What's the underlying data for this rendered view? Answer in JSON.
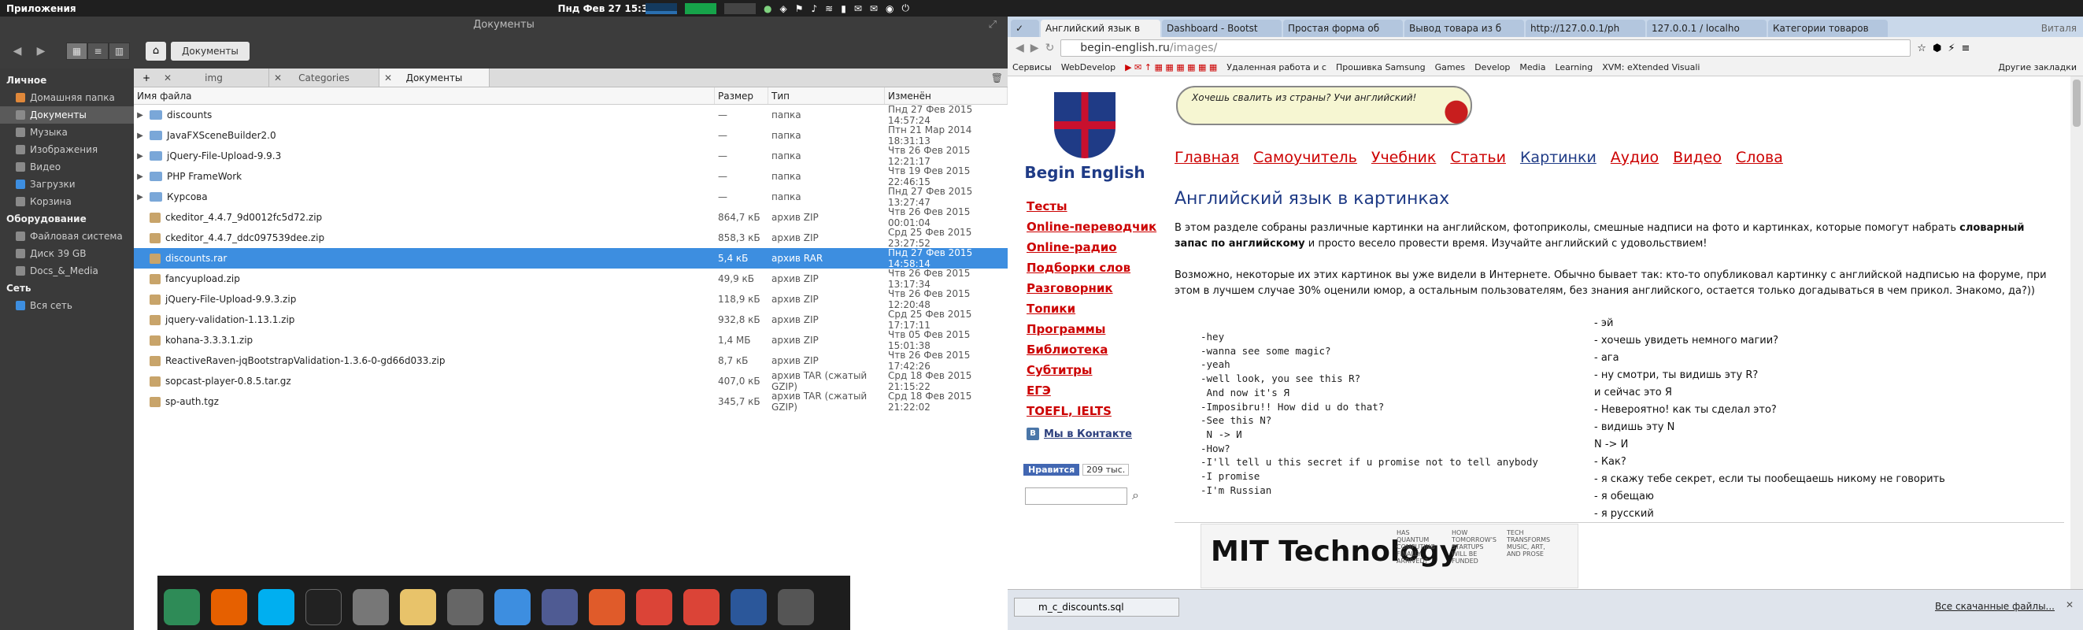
{
  "topbar": {
    "apps": "Приложения",
    "clock": "Пнд Фев 27 15:31"
  },
  "filemanager": {
    "title": "Документы",
    "breadcrumb": "Документы",
    "sidebar": {
      "personal_header": "Личное",
      "personal": [
        "Домашняя папка",
        "Документы",
        "Музыка",
        "Изображения",
        "Видео",
        "Загрузки",
        "Корзина"
      ],
      "hardware_header": "Оборудование",
      "hardware": [
        "Файловая система",
        "Диск 39 GB",
        "Docs_&_Media"
      ],
      "network_header": "Сеть",
      "network": [
        "Вся сеть"
      ]
    },
    "tabs": [
      "img",
      "Categories",
      "Документы"
    ],
    "columns": {
      "name": "Имя файла",
      "size": "Размер",
      "type": "Тип",
      "modified": "Изменён"
    },
    "rows": [
      {
        "name": "discounts",
        "size": "—",
        "type": "папка",
        "modified": "Пнд 27 Фев 2015 14:57:24"
      },
      {
        "name": "JavaFXSceneBuilder2.0",
        "size": "—",
        "type": "папка",
        "modified": "Птн 21 Мар 2014 18:31:13"
      },
      {
        "name": "jQuery-File-Upload-9.9.3",
        "size": "—",
        "type": "папка",
        "modified": "Чтв 26 Фев 2015 12:21:17"
      },
      {
        "name": "PHP FrameWork",
        "size": "—",
        "type": "папка",
        "modified": "Чтв 19 Фев 2015 22:46:15"
      },
      {
        "name": "Курсова",
        "size": "—",
        "type": "папка",
        "modified": "Пнд 27 Фев 2015 13:27:47"
      },
      {
        "name": "ckeditor_4.4.7_9d0012fc5d72.zip",
        "size": "864,7 кБ",
        "type": "архив ZIP",
        "modified": "Чтв 26 Фев 2015 00:01:04"
      },
      {
        "name": "ckeditor_4.4.7_ddc097539dee.zip",
        "size": "858,3 кБ",
        "type": "архив ZIP",
        "modified": "Срд 25 Фев 2015 23:27:52"
      },
      {
        "name": "discounts.rar",
        "size": "5,4 кБ",
        "type": "архив RAR",
        "modified": "Пнд 27 Фев 2015 14:58:14"
      },
      {
        "name": "fancyupload.zip",
        "size": "49,9 кБ",
        "type": "архив ZIP",
        "modified": "Чтв 26 Фев 2015 13:17:34"
      },
      {
        "name": "jQuery-File-Upload-9.9.3.zip",
        "size": "118,9 кБ",
        "type": "архив ZIP",
        "modified": "Чтв 26 Фев 2015 12:20:48"
      },
      {
        "name": "jquery-validation-1.13.1.zip",
        "size": "932,8 кБ",
        "type": "архив ZIP",
        "modified": "Срд 25 Фев 2015 17:17:11"
      },
      {
        "name": "kohana-3.3.3.1.zip",
        "size": "1,4 МБ",
        "type": "архив ZIP",
        "modified": "Чтв 05 Фев 2015 15:01:38"
      },
      {
        "name": "ReactiveRaven-jqBootstrapValidation-1.3.6-0-gd66d033.zip",
        "size": "8,7 кБ",
        "type": "архив ZIP",
        "modified": "Чтв 26 Фев 2015 17:42:26"
      },
      {
        "name": "sopcast-player-0.8.5.tar.gz",
        "size": "407,0 кБ",
        "type": "архив TAR (сжатый GZIP)",
        "modified": "Срд 18 Фев 2015 21:15:22"
      },
      {
        "name": "sp-auth.tgz",
        "size": "345,7 кБ",
        "type": "архив TAR (сжатый GZIP)",
        "modified": "Срд 18 Фев 2015 21:22:02"
      }
    ]
  },
  "browser": {
    "tabs": [
      "Английский язык в",
      "Dashboard - Bootst",
      "Простая форма об",
      "Вывод товара из б",
      "http://127.0.0.1/ph",
      "127.0.0.1 / localho",
      "Категории товаров"
    ],
    "user": "Виталя",
    "url_host": "begin-english.ru",
    "url_path": "/images/",
    "bookmarks": [
      "Сервисы",
      "WebDevelop",
      "Удаленная работа и с",
      "Прошивка Samsung",
      "Games",
      "Develop",
      "Media",
      "Learning",
      "XVM: eXtended Visuali"
    ],
    "bookmarks_other": "Другие закладки",
    "site": {
      "logo": "Begin English",
      "bubble": "Хочешь свалить из страны? Учи английский!",
      "topnav": [
        "Главная",
        "Самоучитель",
        "Учебник",
        "Статьи",
        "Картинки",
        "Аудио",
        "Видео",
        "Слова"
      ],
      "leftnav": [
        "Тесты",
        "Online-переводчик",
        "Online-радио",
        "Подборки слов",
        "Разговорник",
        "Топики",
        "Программы",
        "Библиотека",
        "Субтитры",
        "ЕГЭ",
        "TOEFL, IELTS"
      ],
      "vk": "Мы в Контакте",
      "fb_like": "Нравится",
      "fb_count": "209 тыс.",
      "heading": "Английский язык в картинках",
      "p1_a": "В этом разделе собраны различные картинки на английском, фотоприколы, смешные надписи на фото и картинках, которые помогут  набрать ",
      "p1_b": "словарный запас по английскому",
      "p1_c": " и просто весело провести время. Изучайте английский с удовольствием!",
      "p2": "Возможно, некоторые их этих картинок вы уже видели в Интернете. Обычно бывает так: кто-то опубликовал картинку с английской надписью на форуме, при этом в лучшем случае 30% оценили юмор, а остальным пользователям, без знания английского, остается только догадываться в чем прикол. Знакомо, да?))",
      "code": "-hey\n-wanna see some magic?\n-yeah\n-well look, you see this R?\n And now it's Я\n-Imposibru!! How did u do that?\n-See this N?\n N -> И\n-How?\n-I'll tell u this secret if u promise not to tell anybody\n-I promise\n-I'm Russian",
      "translation": [
        "- эй",
        "- хочешь увидеть немного магии?",
        "- ага",
        "- ну смотри, ты видишь эту R?",
        "и сейчас это Я",
        "- Невероятно! как ты сделал это?",
        "- видишь эту N",
        "N -> И",
        "- Как?",
        "- я скажу тебе секрет, если ты пообещаешь никому не говорить",
        "- я обещаю",
        "- я русский"
      ],
      "mit_big": "MIT Technology",
      "mit_s1": "HAS QUANTUM COMPUTING FINALLY ARRIVED?",
      "mit_s2": "HOW TOMORROW'S STARTUPS WILL BE FUNDED",
      "mit_s3": "TECH TRANSFORMS MUSIC, ART, AND PROSE"
    },
    "download": {
      "file": "m_c_discounts.sql",
      "all": "Все скачанные файлы..."
    }
  }
}
